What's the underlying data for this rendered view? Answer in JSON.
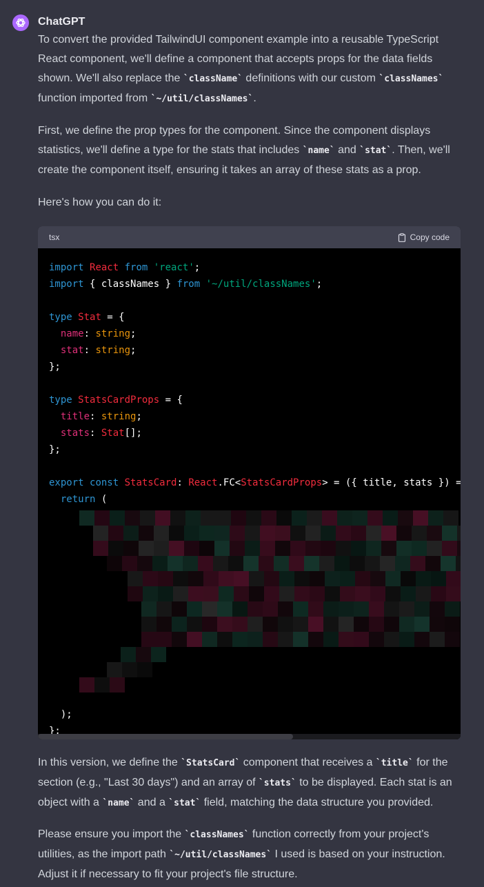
{
  "author": "ChatGPT",
  "message": {
    "p1": [
      {
        "t": "To convert the provided TailwindUI component example into a reusable TypeScript React component, we'll define a component that accepts props for the data fields shown. We'll also replace the "
      },
      {
        "c": "`className`"
      },
      {
        "t": " definitions with our custom "
      },
      {
        "c": "`classNames`"
      },
      {
        "t": " function imported from "
      },
      {
        "c": "`~/util/classNames`"
      },
      {
        "t": "."
      }
    ],
    "p2": [
      {
        "t": "First, we define the prop types for the component. Since the component displays statistics, we'll define a type for the stats that includes "
      },
      {
        "c": "`name`"
      },
      {
        "t": " and "
      },
      {
        "c": "`stat`"
      },
      {
        "t": ". Then, we'll create the component itself, ensuring it takes an array of these stats as a prop."
      }
    ],
    "p3": [
      {
        "t": "Here's how you can do it:"
      }
    ],
    "p4": [
      {
        "t": "In this version, we define the "
      },
      {
        "c": "`StatsCard`"
      },
      {
        "t": " component that receives a "
      },
      {
        "c": "`title`"
      },
      {
        "t": " for the section (e.g., \"Last 30 days\") and an array of "
      },
      {
        "c": "`stats`"
      },
      {
        "t": " to be displayed. Each stat is an object with a "
      },
      {
        "c": "`name`"
      },
      {
        "t": " and a "
      },
      {
        "c": "`stat`"
      },
      {
        "t": " field, matching the data structure you provided."
      }
    ],
    "p5": [
      {
        "t": "Please ensure you import the "
      },
      {
        "c": "`classNames`"
      },
      {
        "t": " function correctly from your project's utilities, as the import path "
      },
      {
        "c": "`~/util/classNames`"
      },
      {
        "t": " I used is based on your instruction. Adjust it if necessary to fit your project's file structure."
      }
    ]
  },
  "code_block": {
    "language": "tsx",
    "copy_label": "Copy code",
    "lines": [
      [
        [
          "kw",
          "import "
        ],
        [
          "ty",
          "React "
        ],
        [
          "kw",
          "from "
        ],
        [
          "str",
          "'react'"
        ],
        [
          "",
          "; "
        ]
      ],
      [
        [
          "kw",
          "import "
        ],
        [
          "",
          "{ classNames } "
        ],
        [
          "kw",
          "from "
        ],
        [
          "str",
          "'~/util/classNames'"
        ],
        [
          "",
          ";"
        ]
      ],
      [],
      [
        [
          "kw",
          "type "
        ],
        [
          "ty",
          "Stat"
        ],
        [
          "",
          " = {"
        ]
      ],
      [
        [
          "",
          "  "
        ],
        [
          "prop",
          "name"
        ],
        [
          "",
          ": "
        ],
        [
          "prim",
          "string"
        ],
        [
          "",
          ";"
        ]
      ],
      [
        [
          "",
          "  "
        ],
        [
          "prop",
          "stat"
        ],
        [
          "",
          ": "
        ],
        [
          "prim",
          "string"
        ],
        [
          "",
          ";"
        ]
      ],
      [
        [
          "",
          "};"
        ]
      ],
      [],
      [
        [
          "kw",
          "type "
        ],
        [
          "ty",
          "StatsCardProps"
        ],
        [
          "",
          " = {"
        ]
      ],
      [
        [
          "",
          "  "
        ],
        [
          "prop",
          "title"
        ],
        [
          "",
          ": "
        ],
        [
          "prim",
          "string"
        ],
        [
          "",
          ";"
        ]
      ],
      [
        [
          "",
          "  "
        ],
        [
          "prop",
          "stats"
        ],
        [
          "",
          ": "
        ],
        [
          "ty",
          "Stat"
        ],
        [
          "",
          "[];"
        ]
      ],
      [
        [
          "",
          "};"
        ]
      ],
      [],
      [
        [
          "kw",
          "export "
        ],
        [
          "kw",
          "const "
        ],
        [
          "ty",
          "StatsCard"
        ],
        [
          "",
          ": "
        ],
        [
          "ty",
          "React"
        ],
        [
          "",
          ".FC<"
        ],
        [
          "ty",
          "StatsCardProps"
        ],
        [
          "",
          "> = ({ title, stats }) => {"
        ]
      ],
      [
        [
          "",
          "  "
        ],
        [
          "kw",
          "return"
        ],
        [
          "",
          " ("
        ]
      ],
      [],
      [],
      [],
      [],
      [],
      [],
      [],
      [],
      [],
      [],
      [],
      [],
      [
        [
          "",
          "  );"
        ]
      ],
      [
        [
          "",
          "};"
        ]
      ]
    ]
  }
}
